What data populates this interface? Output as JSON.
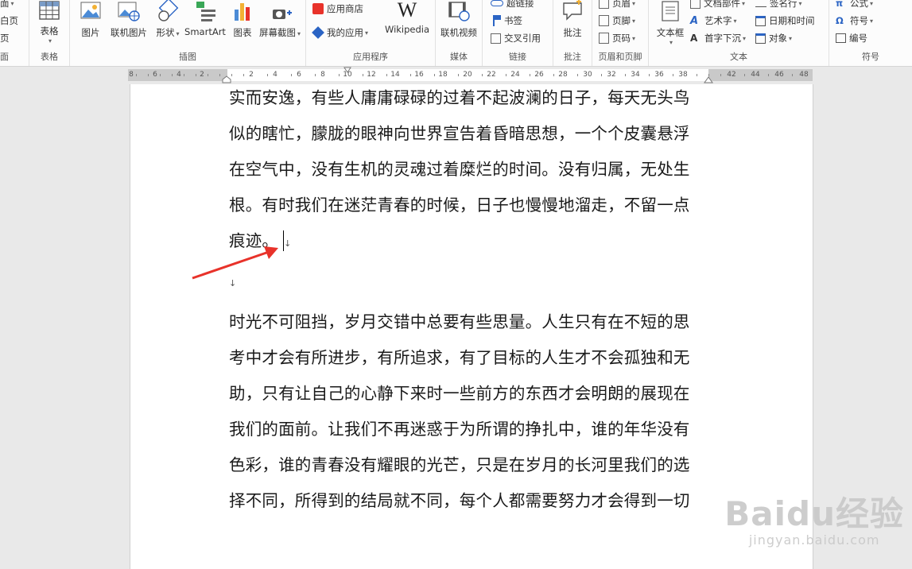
{
  "colors": {
    "ribbon_bg": "#fcfcfc",
    "accent_red": "#e8322a",
    "accent_blue": "#2b64c4",
    "document_bg": "#e9e9e9"
  },
  "ribbon": {
    "left_partial": {
      "item1": "面",
      "item2": "白页",
      "item3": "页",
      "group": "面"
    },
    "tables": {
      "button": "表格",
      "group": "表格"
    },
    "illustrations": {
      "picture": "图片",
      "online_picture": "联机图片",
      "shapes": "形状",
      "smartart": "SmartArt",
      "chart": "图表",
      "screenshot": "屏幕截图",
      "group": "插图"
    },
    "apps": {
      "store": "应用商店",
      "my_apps": "我的应用",
      "wikipedia_logo": "W",
      "wikipedia": "Wikipedia",
      "group": "应用程序"
    },
    "media": {
      "online_video": "联机视频",
      "group": "媒体"
    },
    "links": {
      "hyperlink": "超链接",
      "bookmark": "书签",
      "cross_ref": "交叉引用",
      "group": "链接"
    },
    "comments": {
      "comment": "批注",
      "group": "批注"
    },
    "header_footer": {
      "header": "页眉",
      "footer": "页脚",
      "page_number": "页码",
      "group": "页眉和页脚"
    },
    "text": {
      "textbox": "文本框",
      "quick_parts": "文档部件",
      "wordart": "艺术字",
      "dropcap": "首字下沉",
      "signature": "签名行",
      "datetime": "日期和时间",
      "object": "对象",
      "group": "文本"
    },
    "symbols": {
      "equation_icon": "π",
      "equation": "公式",
      "symbol_icon": "Ω",
      "symbol": "符号",
      "number": "编号",
      "group": "符号"
    }
  },
  "ruler": {
    "labels": [
      "8",
      "6",
      "4",
      "2",
      "2",
      "4",
      "6",
      "8",
      "10",
      "12",
      "14",
      "16",
      "18",
      "20",
      "22",
      "24",
      "26",
      "28",
      "30",
      "32",
      "34",
      "36",
      "38",
      "42",
      "44",
      "46",
      "48"
    ]
  },
  "document": {
    "para1": [
      "实而安逸，有些人庸庸碌碌的过着不起波澜的日子，每天无头鸟",
      "似的瞎忙，朦胧的眼神向世界宣告着昏暗思想，一个个皮囊悬浮",
      "在空气中，没有生机的灵魂过着糜烂的时间。没有归属，无处生",
      "根。有时我们在迷茫青春的时候，日子也慢慢地溜走，不留一点",
      "痕迹。"
    ],
    "paragraph_mark": "↓",
    "para2": [
      "时光不可阻挡，岁月交错中总要有些思量。人生只有在不短的思",
      "考中才会有所进步，有所追求，有了目标的人生才不会孤独和无",
      "助，只有让自己的心静下来时一些前方的东西才会明朗的展现在",
      "我们的面前。让我们不再迷惑于为所谓的挣扎中，谁的年华没有",
      "色彩，谁的青春没有耀眼的光芒，只是在岁月的长河里我们的选",
      "择不同，所得到的结局就不同，每个人都需要努力才会得到一切"
    ]
  },
  "watermark": {
    "logo": "Baidu经验",
    "url": "jingyan.baidu.com"
  }
}
